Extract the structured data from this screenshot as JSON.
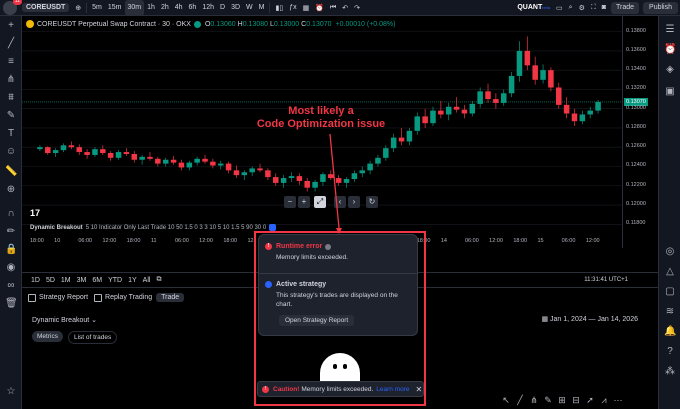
{
  "topbar": {
    "avatar_badge": "11",
    "symbol": "COREUSDT",
    "timeframes": [
      "5m",
      "15m",
      "30m",
      "1h",
      "2h",
      "4h",
      "6h",
      "12h",
      "D",
      "3D",
      "W",
      "M"
    ],
    "active_timeframe": "30m",
    "brand_name": "QUANT",
    "brand_sub": "beta",
    "trade_label": "Trade",
    "publish_label": "Publish"
  },
  "chart": {
    "symbol_title": "COREUSDT Perpetual Swap Contract · 30 · OKX",
    "ohlc": {
      "o_label": "O",
      "o": "0.13060",
      "h_label": "H",
      "h": "0.13080",
      "l_label": "L",
      "l": "0.13000",
      "c_label": "C",
      "c": "0.13070"
    },
    "change": "+0.00010 (+0.08%)",
    "indicator_name": "Dynamic Breakout",
    "indicator_params": "5 10 Indicator Only Last Trade 10 50 1.5 0 3 3 10 5 10 1.5 5 90 30 0",
    "current_price": "0.13070",
    "price_labels": [
      "0.13800",
      "0.13600",
      "0.13400",
      "0.13200",
      "0.13000",
      "0.12800",
      "0.12600",
      "0.12400",
      "0.12200",
      "0.12000",
      "0.11800"
    ],
    "time_labels": [
      {
        "t": "18:00"
      },
      {
        "t": "10"
      },
      {
        "t": "06:00"
      },
      {
        "t": "12:00"
      },
      {
        "t": "18:00"
      },
      {
        "t": "11"
      },
      {
        "t": "06:00"
      },
      {
        "t": "12:00"
      },
      {
        "t": "18:00"
      },
      {
        "t": "12"
      },
      {
        "t": "06:00"
      },
      {
        "t": "12:00"
      },
      {
        "t": "18:00"
      },
      {
        "t": "13"
      },
      {
        "t": "06:00"
      },
      {
        "t": "12:00"
      },
      {
        "t": "18:00"
      },
      {
        "t": "14"
      },
      {
        "t": "06:00"
      },
      {
        "t": "12:00"
      },
      {
        "t": "18:00"
      },
      {
        "t": "15"
      },
      {
        "t": "06:00"
      },
      {
        "t": "12:00"
      }
    ],
    "tv_logo": "17"
  },
  "annotation": {
    "line1": "Most likely a",
    "line2": "Code Optimization issue"
  },
  "rangebar": {
    "ranges": [
      "1D",
      "5D",
      "1M",
      "3M",
      "6M",
      "YTD",
      "1Y",
      "All"
    ],
    "time": "11:31:41 UTC+1"
  },
  "panel": {
    "tab_strategy_report": "Strategy Report",
    "tab_replay_trading": "Replay Trading",
    "tab_trade": "Trade",
    "strategy_name": "Dynamic Breakout",
    "subtab_metrics": "Metrics",
    "subtab_trades": "List of trades",
    "date_range": "Jan 1, 2024 — Jan 14, 2026"
  },
  "popup": {
    "error_title": "Runtime error",
    "error_text": "Memory limits exceeded.",
    "active_title": "Active strategy",
    "active_text_1": "This strategy's trades are displayed on the",
    "active_text_2": "chart.",
    "open_report_button": "Open Strategy Report"
  },
  "toast": {
    "caution": "Caution!",
    "message": "Memory limits exceeded.",
    "link": "Learn more"
  },
  "candles": [
    [
      0.1258,
      0.1262,
      0.1256,
      0.126
    ],
    [
      0.126,
      0.1261,
      0.1252,
      0.1254
    ],
    [
      0.1254,
      0.1259,
      0.125,
      0.1257
    ],
    [
      0.1257,
      0.1264,
      0.1255,
      0.1262
    ],
    [
      0.1262,
      0.1266,
      0.1258,
      0.126
    ],
    [
      0.126,
      0.1263,
      0.1252,
      0.1255
    ],
    [
      0.1255,
      0.1258,
      0.1248,
      0.1252
    ],
    [
      0.1252,
      0.126,
      0.125,
      0.1258
    ],
    [
      0.1258,
      0.1262,
      0.1252,
      0.1254
    ],
    [
      0.1254,
      0.1256,
      0.1246,
      0.1249
    ],
    [
      0.1249,
      0.1257,
      0.1247,
      0.1255
    ],
    [
      0.1255,
      0.1259,
      0.1251,
      0.1253
    ],
    [
      0.1253,
      0.1256,
      0.1244,
      0.1247
    ],
    [
      0.1247,
      0.1252,
      0.1242,
      0.125
    ],
    [
      0.125,
      0.1255,
      0.1246,
      0.1248
    ],
    [
      0.1248,
      0.125,
      0.124,
      0.1243
    ],
    [
      0.1243,
      0.1249,
      0.124,
      0.1247
    ],
    [
      0.1247,
      0.1251,
      0.1242,
      0.1244
    ],
    [
      0.1244,
      0.1247,
      0.1236,
      0.1239
    ],
    [
      0.1239,
      0.1246,
      0.1236,
      0.1244
    ],
    [
      0.1244,
      0.125,
      0.1241,
      0.1248
    ],
    [
      0.1248,
      0.1252,
      0.1243,
      0.1245
    ],
    [
      0.1245,
      0.1248,
      0.1238,
      0.1241
    ],
    [
      0.1241,
      0.1246,
      0.1237,
      0.1243
    ],
    [
      0.1243,
      0.1245,
      0.1233,
      0.1236
    ],
    [
      0.1236,
      0.1241,
      0.1228,
      0.1231
    ],
    [
      0.1231,
      0.1236,
      0.1226,
      0.1234
    ],
    [
      0.1234,
      0.124,
      0.123,
      0.1238
    ],
    [
      0.1238,
      0.1243,
      0.1234,
      0.1236
    ],
    [
      0.1236,
      0.1238,
      0.1226,
      0.1229
    ],
    [
      0.1229,
      0.1233,
      0.122,
      0.1223
    ],
    [
      0.1223,
      0.1231,
      0.1218,
      0.1228
    ],
    [
      0.1228,
      0.1234,
      0.1224,
      0.123
    ],
    [
      0.123,
      0.1233,
      0.1221,
      0.1225
    ],
    [
      0.1225,
      0.1228,
      0.1214,
      0.1218
    ],
    [
      0.1218,
      0.1226,
      0.1214,
      0.1224
    ],
    [
      0.1224,
      0.1234,
      0.122,
      0.1232
    ],
    [
      0.1232,
      0.1236,
      0.1226,
      0.1228
    ],
    [
      0.1228,
      0.1231,
      0.122,
      0.1223
    ],
    [
      0.1223,
      0.1229,
      0.1218,
      0.1227
    ],
    [
      0.1227,
      0.1236,
      0.1224,
      0.1233
    ],
    [
      0.1233,
      0.124,
      0.1229,
      0.1236
    ],
    [
      0.1236,
      0.1246,
      0.1232,
      0.1243
    ],
    [
      0.1243,
      0.1252,
      0.124,
      0.1249
    ],
    [
      0.1249,
      0.1262,
      0.1246,
      0.1259
    ],
    [
      0.1259,
      0.1274,
      0.1255,
      0.127
    ],
    [
      0.127,
      0.128,
      0.1262,
      0.1266
    ],
    [
      0.1266,
      0.128,
      0.1262,
      0.1277
    ],
    [
      0.1277,
      0.1296,
      0.1273,
      0.1292
    ],
    [
      0.1292,
      0.13,
      0.128,
      0.1285
    ],
    [
      0.1285,
      0.1302,
      0.1282,
      0.1298
    ],
    [
      0.1298,
      0.1308,
      0.129,
      0.1294
    ],
    [
      0.1294,
      0.1306,
      0.1288,
      0.1302
    ],
    [
      0.1302,
      0.1312,
      0.1296,
      0.1299
    ],
    [
      0.1299,
      0.1304,
      0.129,
      0.1295
    ],
    [
      0.1295,
      0.1308,
      0.1292,
      0.1305
    ],
    [
      0.1305,
      0.1322,
      0.1301,
      0.1318
    ],
    [
      0.1318,
      0.1326,
      0.1306,
      0.131
    ],
    [
      0.131,
      0.1316,
      0.13,
      0.1306
    ],
    [
      0.1306,
      0.132,
      0.1303,
      0.1316
    ],
    [
      0.1316,
      0.1338,
      0.1312,
      0.1334
    ],
    [
      0.1334,
      0.137,
      0.1328,
      0.136
    ],
    [
      0.136,
      0.1375,
      0.134,
      0.1345
    ],
    [
      0.1345,
      0.1354,
      0.1325,
      0.133
    ],
    [
      0.133,
      0.1346,
      0.1326,
      0.134
    ],
    [
      0.134,
      0.1343,
      0.1318,
      0.1322
    ],
    [
      0.1322,
      0.1327,
      0.13,
      0.1304
    ],
    [
      0.1304,
      0.1312,
      0.129,
      0.1295
    ],
    [
      0.1295,
      0.13,
      0.1282,
      0.1287
    ],
    [
      0.1287,
      0.1298,
      0.1284,
      0.1294
    ],
    [
      0.1294,
      0.1302,
      0.129,
      0.1298
    ],
    [
      0.1298,
      0.1309,
      0.1295,
      0.1307
    ]
  ]
}
